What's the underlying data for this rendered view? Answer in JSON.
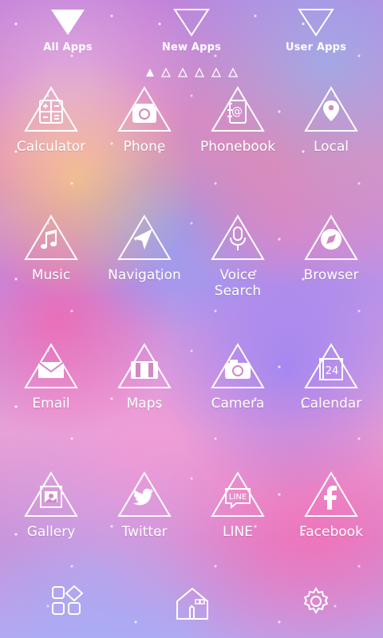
{
  "top_tabs": [
    {
      "label": "All Apps"
    },
    {
      "label": "New Apps"
    },
    {
      "label": "User Apps"
    }
  ],
  "apps": [
    {
      "label": "Calculator",
      "icon": "calculator-icon"
    },
    {
      "label": "Phone",
      "icon": "phone-icon"
    },
    {
      "label": "Phonebook",
      "icon": "phonebook-icon"
    },
    {
      "label": "Local",
      "icon": "location-pin-icon"
    },
    {
      "label": "Music",
      "icon": "music-note-icon"
    },
    {
      "label": "Navigation",
      "icon": "navigation-arrow-icon"
    },
    {
      "label": "Voice\nSearch",
      "icon": "microphone-icon"
    },
    {
      "label": "Browser",
      "icon": "compass-icon"
    },
    {
      "label": "Email",
      "icon": "envelope-icon"
    },
    {
      "label": "Maps",
      "icon": "map-icon"
    },
    {
      "label": "Camera",
      "icon": "camera-icon"
    },
    {
      "label": "Calendar",
      "icon": "calendar-icon"
    },
    {
      "label": "Gallery",
      "icon": "gallery-icon"
    },
    {
      "label": "Twitter",
      "icon": "twitter-bird-icon"
    },
    {
      "label": "LINE",
      "icon": "line-chat-icon"
    },
    {
      "label": "Facebook",
      "icon": "facebook-icon"
    }
  ],
  "calendar_day": "24",
  "line_text": "LINE",
  "dock": [
    {
      "icon": "apps-grid-icon"
    },
    {
      "icon": "home-icon"
    },
    {
      "icon": "settings-gear-icon"
    }
  ],
  "colors": {
    "icon_white": "#ffffff",
    "bg_pink": "#e48bc0",
    "bg_purple": "#b992e8"
  }
}
